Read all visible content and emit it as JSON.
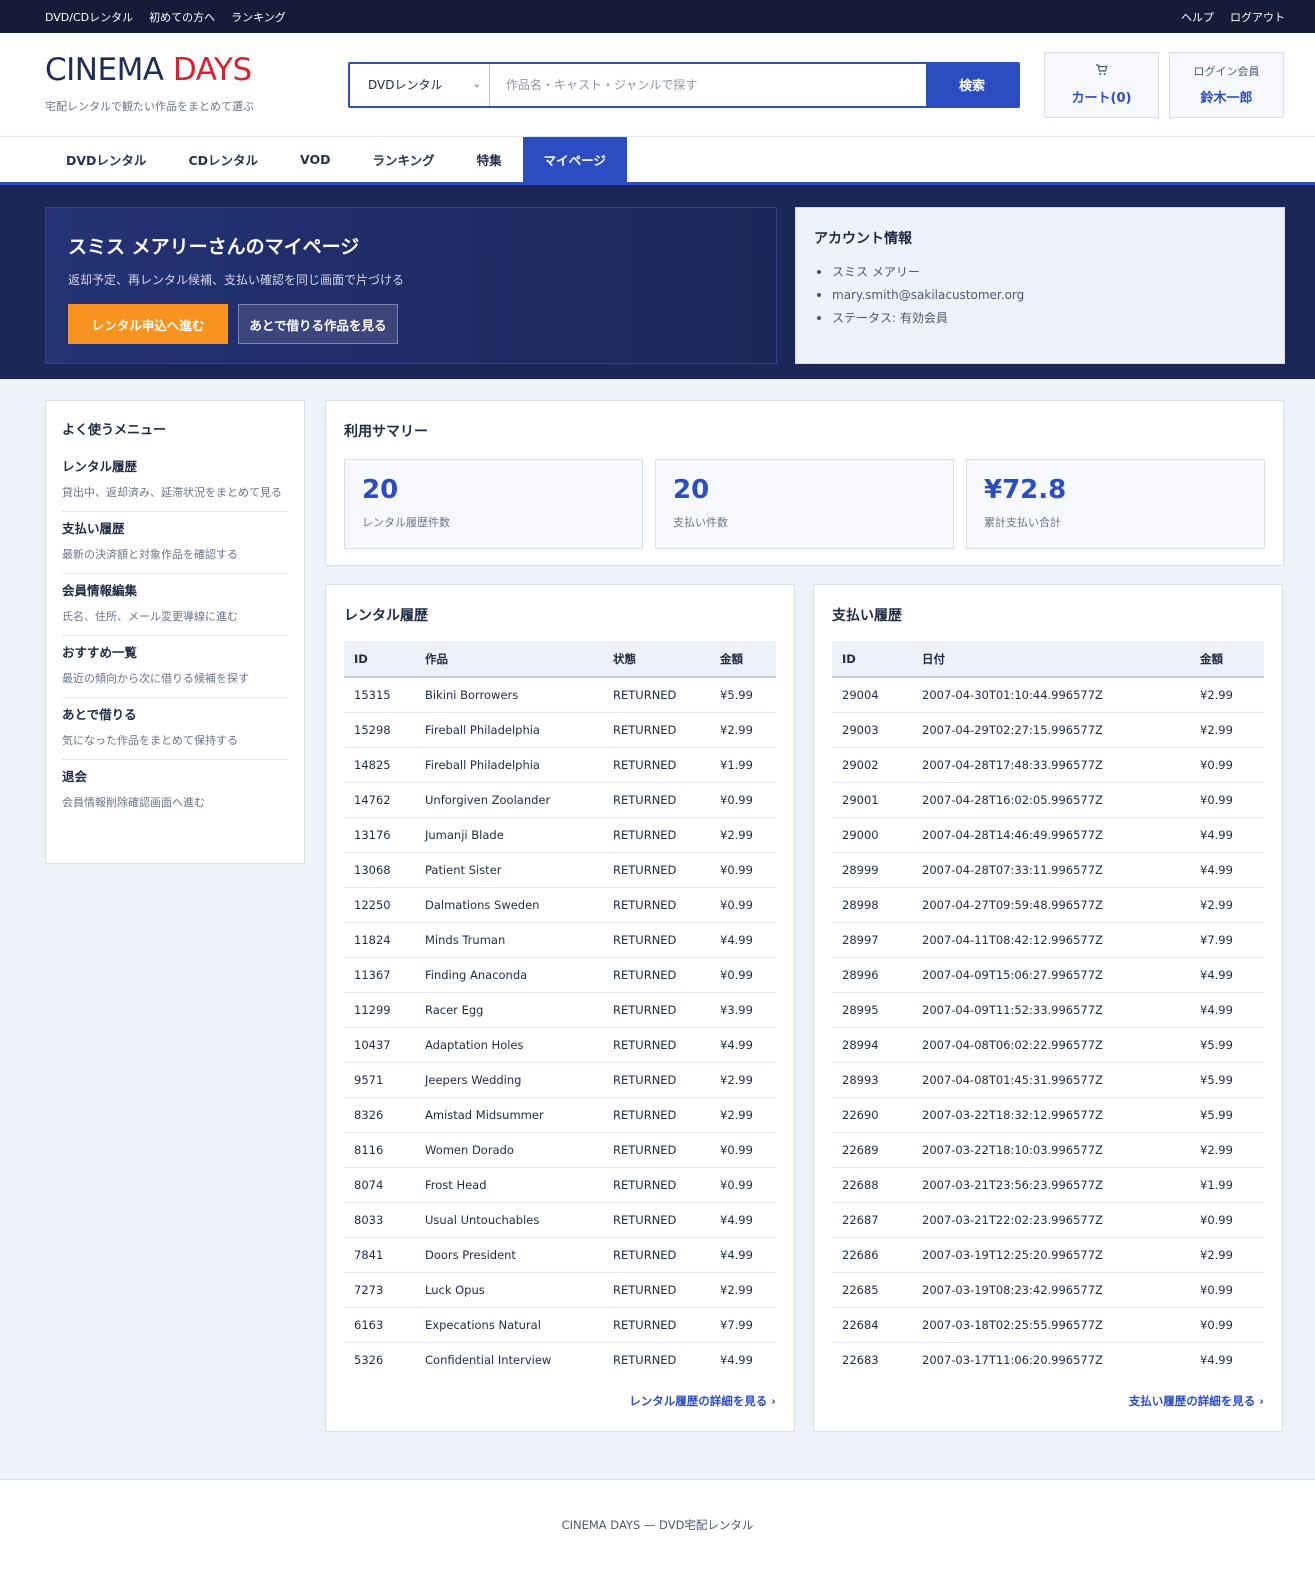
{
  "util": {
    "left": [
      "DVD/CDレンタル",
      "初めての方へ",
      "ランキング"
    ],
    "right": [
      "ヘルプ",
      "ログアウト"
    ]
  },
  "header": {
    "logo_part1": "CINEMA",
    "logo_part2": "DAYS",
    "tagline": "宅配レンタルで観たい作品をまとめて選ぶ",
    "search_select": "DVDレンタル",
    "search_placeholder": "作品名・キャスト・ジャンルで探す",
    "search_button": "検索",
    "cart_label": "カート(0)",
    "member_label": "ログイン会員",
    "member_name": "鈴木一郎"
  },
  "nav": {
    "tabs": [
      "DVDレンタル",
      "CDレンタル",
      "VOD",
      "ランキング",
      "特集",
      "マイページ"
    ],
    "active": "マイページ"
  },
  "hero": {
    "title": "スミス メアリーさんのマイページ",
    "subtitle": "返却予定、再レンタル候補、支払い確認を同じ画面で片づける",
    "primary_button": "レンタル申込へ進む",
    "secondary_button": "あとで借りる作品を見る"
  },
  "account": {
    "title": "アカウント情報",
    "items": [
      "スミス メアリー",
      "mary.smith@sakilacustomer.org",
      "ステータス: 有効会員"
    ]
  },
  "sidebar": {
    "title": "よく使うメニュー",
    "items": [
      {
        "title": "レンタル履歴",
        "desc": "貸出中、返却済み、延滞状況をまとめて見る"
      },
      {
        "title": "支払い履歴",
        "desc": "最新の決済額と対象作品を確認する"
      },
      {
        "title": "会員情報編集",
        "desc": "氏名、住所、メール変更導線に進む"
      },
      {
        "title": "おすすめ一覧",
        "desc": "最近の傾向から次に借りる候補を探す"
      },
      {
        "title": "あとで借りる",
        "desc": "気になった作品をまとめて保持する"
      },
      {
        "title": "退会",
        "desc": "会員情報削除確認画面へ進む"
      }
    ]
  },
  "summary": {
    "title": "利用サマリー",
    "stats": [
      {
        "value": "20",
        "label": "レンタル履歴件数"
      },
      {
        "value": "20",
        "label": "支払い件数"
      },
      {
        "value": "¥72.8",
        "label": "累計支払い合計"
      }
    ]
  },
  "rentals": {
    "title": "レンタル履歴",
    "headers": [
      "ID",
      "作品",
      "状態",
      "金額"
    ],
    "rows": [
      [
        "15315",
        "Bikini Borrowers",
        "RETURNED",
        "¥5.99"
      ],
      [
        "15298",
        "Fireball Philadelphia",
        "RETURNED",
        "¥2.99"
      ],
      [
        "14825",
        "Fireball Philadelphia",
        "RETURNED",
        "¥1.99"
      ],
      [
        "14762",
        "Unforgiven Zoolander",
        "RETURNED",
        "¥0.99"
      ],
      [
        "13176",
        "Jumanji Blade",
        "RETURNED",
        "¥2.99"
      ],
      [
        "13068",
        "Patient Sister",
        "RETURNED",
        "¥0.99"
      ],
      [
        "12250",
        "Dalmations Sweden",
        "RETURNED",
        "¥0.99"
      ],
      [
        "11824",
        "Minds Truman",
        "RETURNED",
        "¥4.99"
      ],
      [
        "11367",
        "Finding Anaconda",
        "RETURNED",
        "¥0.99"
      ],
      [
        "11299",
        "Racer Egg",
        "RETURNED",
        "¥3.99"
      ],
      [
        "10437",
        "Adaptation Holes",
        "RETURNED",
        "¥4.99"
      ],
      [
        "9571",
        "Jeepers Wedding",
        "RETURNED",
        "¥2.99"
      ],
      [
        "8326",
        "Amistad Midsummer",
        "RETURNED",
        "¥2.99"
      ],
      [
        "8116",
        "Women Dorado",
        "RETURNED",
        "¥0.99"
      ],
      [
        "8074",
        "Frost Head",
        "RETURNED",
        "¥0.99"
      ],
      [
        "8033",
        "Usual Untouchables",
        "RETURNED",
        "¥4.99"
      ],
      [
        "7841",
        "Doors President",
        "RETURNED",
        "¥4.99"
      ],
      [
        "7273",
        "Luck Opus",
        "RETURNED",
        "¥2.99"
      ],
      [
        "6163",
        "Expecations Natural",
        "RETURNED",
        "¥7.99"
      ],
      [
        "5326",
        "Confidential Interview",
        "RETURNED",
        "¥4.99"
      ]
    ],
    "more": "レンタル履歴の詳細を見る ›"
  },
  "payments": {
    "title": "支払い履歴",
    "headers": [
      "ID",
      "日付",
      "金額"
    ],
    "rows": [
      [
        "29004",
        "2007-04-30T01:10:44.996577Z",
        "¥2.99"
      ],
      [
        "29003",
        "2007-04-29T02:27:15.996577Z",
        "¥2.99"
      ],
      [
        "29002",
        "2007-04-28T17:48:33.996577Z",
        "¥0.99"
      ],
      [
        "29001",
        "2007-04-28T16:02:05.996577Z",
        "¥0.99"
      ],
      [
        "29000",
        "2007-04-28T14:46:49.996577Z",
        "¥4.99"
      ],
      [
        "28999",
        "2007-04-28T07:33:11.996577Z",
        "¥4.99"
      ],
      [
        "28998",
        "2007-04-27T09:59:48.996577Z",
        "¥2.99"
      ],
      [
        "28997",
        "2007-04-11T08:42:12.996577Z",
        "¥7.99"
      ],
      [
        "28996",
        "2007-04-09T15:06:27.996577Z",
        "¥4.99"
      ],
      [
        "28995",
        "2007-04-09T11:52:33.996577Z",
        "¥4.99"
      ],
      [
        "28994",
        "2007-04-08T06:02:22.996577Z",
        "¥5.99"
      ],
      [
        "28993",
        "2007-04-08T01:45:31.996577Z",
        "¥5.99"
      ],
      [
        "22690",
        "2007-03-22T18:32:12.996577Z",
        "¥5.99"
      ],
      [
        "22689",
        "2007-03-22T18:10:03.996577Z",
        "¥2.99"
      ],
      [
        "22688",
        "2007-03-21T23:56:23.996577Z",
        "¥1.99"
      ],
      [
        "22687",
        "2007-03-21T22:02:23.996577Z",
        "¥0.99"
      ],
      [
        "22686",
        "2007-03-19T12:25:20.996577Z",
        "¥2.99"
      ],
      [
        "22685",
        "2007-03-19T08:23:42.996577Z",
        "¥0.99"
      ],
      [
        "22684",
        "2007-03-18T02:25:55.996577Z",
        "¥0.99"
      ],
      [
        "22683",
        "2007-03-17T11:06:20.996577Z",
        "¥4.99"
      ]
    ],
    "more": "支払い履歴の詳細を見る ›"
  },
  "footer": {
    "text": "CINEMA DAYS — DVD宅配レンタル"
  }
}
